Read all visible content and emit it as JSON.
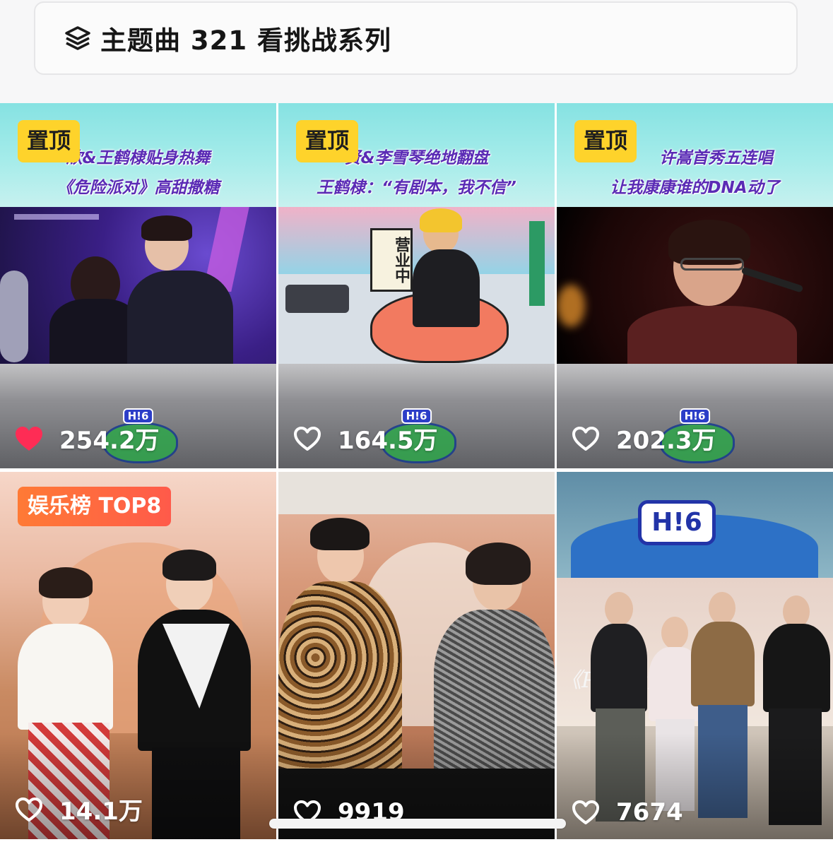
{
  "collection": {
    "icon": "layers-icon",
    "title": "主题曲 321 看挑战系列"
  },
  "tiles": [
    {
      "badge": "置顶",
      "caption": [
        "欣&王鹤棣贴身热舞",
        "《危险派对》高甜撒糖"
      ],
      "likes": "254.2万",
      "liked": true
    },
    {
      "badge": "置顶",
      "caption": [
        "贤&李雪琴绝地翻盘",
        "王鹤棣：“有剧本，我不信”"
      ],
      "scene_sign": "营业中",
      "likes": "164.5万",
      "liked": false
    },
    {
      "badge": "置顶",
      "caption": [
        "许嵩首秀五连唱",
        "让我康康谁的DNA动了"
      ],
      "likes": "202.3万",
      "liked": false
    },
    {
      "badge": "娱乐榜 TOP8",
      "likes": "14.1万",
      "liked": false
    },
    {
      "likes": "9919",
      "liked": false
    },
    {
      "logo_text": "H!6",
      "overlay_text": "《Pretty》",
      "likes": "7674",
      "liked": false
    }
  ],
  "show_logo_text": "H!6",
  "colors": {
    "pin_badge": "#fed32b",
    "rank_badge": "#ff6a40",
    "liked_heart": "#fe2c55"
  }
}
